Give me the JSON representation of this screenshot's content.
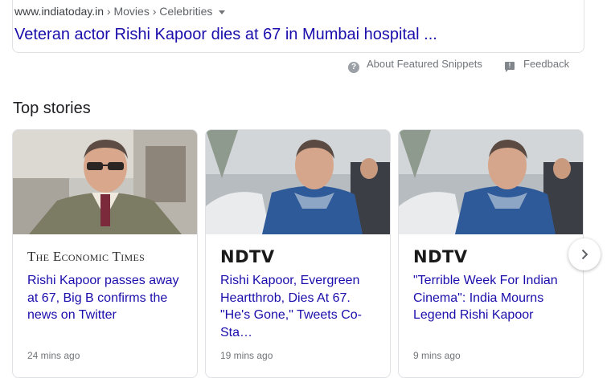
{
  "snippet": {
    "breadcrumb": {
      "domain": "www.indiatoday.in",
      "separator": " › ",
      "section": "Movies",
      "subsection": "Celebrities"
    },
    "title": "Veteran actor Rishi Kapoor dies at 67 in Mumbai hospital ...",
    "about_label": "About Featured Snippets",
    "feedback_label": "Feedback"
  },
  "top_stories": {
    "heading": "Top stories",
    "cards": [
      {
        "publisher": "The Economic Times",
        "title": "Rishi Kapoor passes away at 67, Big B confirms the news on Twitter",
        "time": "24 mins ago"
      },
      {
        "publisher": "NDTV",
        "title": "Rishi Kapoor, Evergreen Heartthrob, Dies At 67. \"He's Gone,\" Tweets Co-Sta…",
        "time": "19 mins ago"
      },
      {
        "publisher": "NDTV",
        "title": "\"Terrible Week For Indian Cinema\": India Mourns Legend Rishi Kapoor",
        "time": "9 mins ago"
      }
    ]
  },
  "icons": {
    "about": "help-circle-icon",
    "feedback": "feedback-icon",
    "next": "chevron-right-icon"
  },
  "colors": {
    "link": "#1a0dab",
    "meta": "#70757a",
    "border": "#dfe1e5"
  }
}
